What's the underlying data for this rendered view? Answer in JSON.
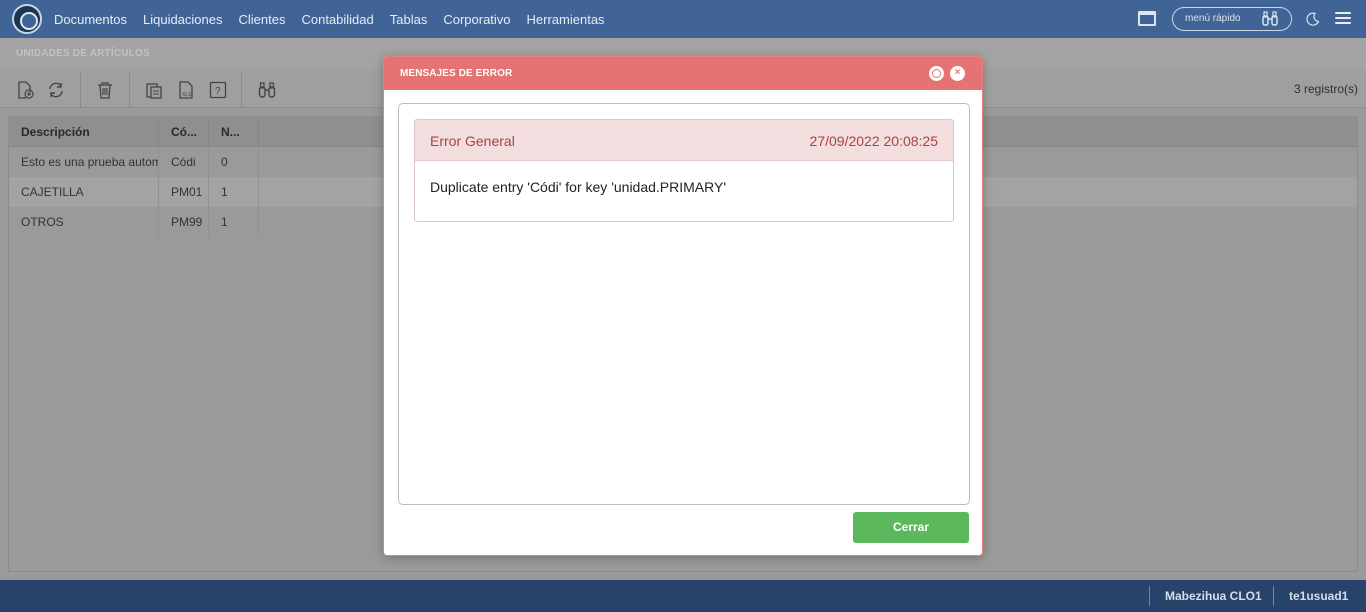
{
  "nav": {
    "items": [
      "Documentos",
      "Liquidaciones",
      "Clientes",
      "Contabilidad",
      "Tablas",
      "Corporativo",
      "Herramientas"
    ],
    "quick_menu_placeholder": "menú rápido"
  },
  "page": {
    "title": "UNIDADES DE ARTÍCULOS"
  },
  "toolbar": {
    "records": "3 registro(s)"
  },
  "table": {
    "headers": [
      "Descripción",
      "Có...",
      "N..."
    ],
    "rows": [
      [
        "Esto es una prueba automa",
        "Códi",
        "0"
      ],
      [
        "CAJETILLA",
        "PM01",
        "1"
      ],
      [
        "OTROS",
        "PM99",
        "1"
      ]
    ]
  },
  "footer": {
    "company": "Mabezihua CLO1",
    "user": "te1usuad1"
  },
  "modal": {
    "title": "MENSAJES DE ERROR",
    "error": {
      "type": "Error General",
      "datetime": "27/09/2022 20:08:25",
      "message": "Duplicate entry 'Códi' for key 'unidad.PRIMARY'"
    },
    "close_button": "Cerrar"
  },
  "colors": {
    "topbar": "#3f6495",
    "modal_header": "#e57373",
    "error_bg": "#f2dede",
    "error_text": "#a94442",
    "close_button": "#5cb85c",
    "footer": "#27436a"
  }
}
